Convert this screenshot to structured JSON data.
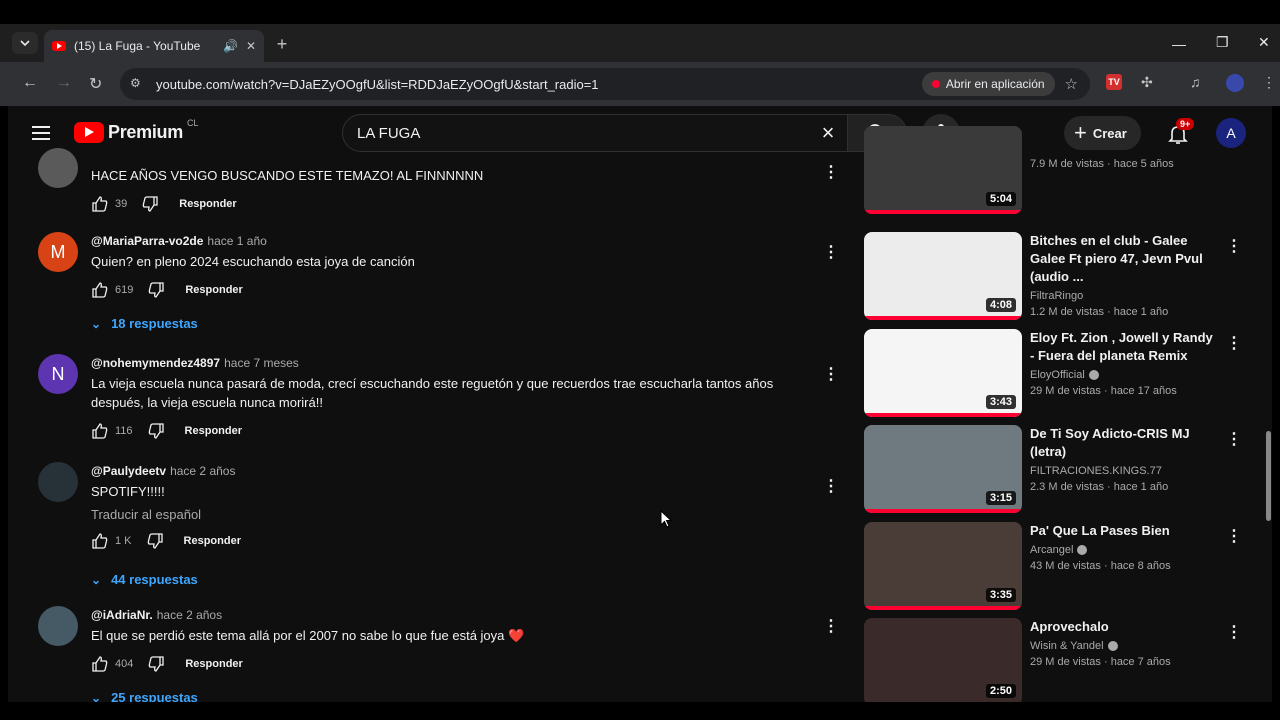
{
  "browser": {
    "tab_title": "(15) La Fuga - YouTube",
    "url": "youtube.com/watch?v=DJaEZyOOgfU&list=RDDJaEZyOOgfU&start_radio=1",
    "open_app_label": "Abrir en aplicación",
    "ext_tv_label": "TV"
  },
  "header": {
    "brand": "Premium",
    "country": "CL",
    "search_query": "LA FUGA",
    "create_label": "Crear",
    "notifications_badge": "9+",
    "avatar_initial": "A"
  },
  "comments": [
    {
      "author": "",
      "ago": "",
      "text": "HACE AÑOS VENGO BUSCANDO ESTE TEMAZO! AL FINNNNNN",
      "likes": "39",
      "reply_label": "Responder",
      "avatar_color": "#5a5a5a",
      "avatar_letter": ""
    },
    {
      "author": "@MariaParra-vo2de",
      "ago": "hace 1 año",
      "text": "Quien? en pleno 2024 escuchando esta joya de canción",
      "likes": "619",
      "reply_label": "Responder",
      "replies": "18 respuestas",
      "avatar_color": "#d84315",
      "avatar_letter": "M"
    },
    {
      "author": "@nohemymendez4897",
      "ago": "hace 7 meses",
      "text": "La vieja escuela nunca pasará de moda, crecí escuchando este reguetón y que recuerdos trae escucharla tantos años después, la vieja escuela nunca morirá!!",
      "likes": "116",
      "reply_label": "Responder",
      "avatar_color": "#5e35b1",
      "avatar_letter": "N"
    },
    {
      "author": "@Paulydeetv",
      "ago": "hace 2 años",
      "text": "SPOTIFY!!!!!",
      "translate": "Traducir al español",
      "likes": "1 K",
      "reply_label": "Responder",
      "replies": "44 respuestas",
      "avatar_color": "#263238",
      "avatar_letter": ""
    },
    {
      "author": "@iAdriaNr.",
      "ago": "hace 2 años",
      "text": "El que se perdió este tema allá por el 2007 no sabe lo que fue está joya ❤️",
      "likes": "404",
      "reply_label": "Responder",
      "replies": "25 respuestas",
      "avatar_color": "#455a64",
      "avatar_letter": ""
    }
  ],
  "related": [
    {
      "title": "",
      "channel": "",
      "meta": "7.9 M de vistas · hace 5 años",
      "duration": "5:04",
      "thumb_color": "#3a3a3a"
    },
    {
      "title": "Bitches en el club - Galee Galee Ft piero 47, Jevn Pvul (audio ...",
      "channel": "FiltraRingo",
      "verified": false,
      "meta": "1.2 M de vistas · hace 1 año",
      "duration": "4:08",
      "thumb_color": "#ececec"
    },
    {
      "title": "Eloy Ft. Zion , Jowell y Randy - Fuera del planeta Remix",
      "channel": "EloyOfficial",
      "verified": true,
      "meta": "29 M de vistas · hace 17 años",
      "duration": "3:43",
      "thumb_color": "#f5f5f5"
    },
    {
      "title": "De Ti Soy Adicto-CRIS MJ (letra)",
      "channel": "FILTRACIONES.KINGS.77",
      "verified": false,
      "meta": "2.3 M de vistas · hace 1 año",
      "duration": "3:15",
      "thumb_color": "#6e7a80"
    },
    {
      "title": "Pa' Que La Pases Bien",
      "channel": "Arcangel",
      "verified": true,
      "meta": "43 M de vistas · hace 8 años",
      "duration": "3:35",
      "thumb_color": "#4a3c36"
    },
    {
      "title": "Aprovechalo",
      "channel": "Wisin & Yandel",
      "verified": true,
      "meta": "29 M de vistas · hace 7 años",
      "duration": "2:50",
      "thumb_color": "#3a2a2a"
    }
  ]
}
